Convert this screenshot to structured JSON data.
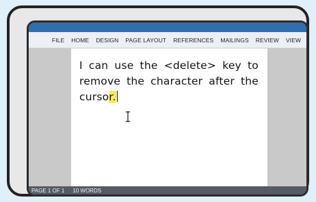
{
  "ribbon": {
    "tabs": [
      "FILE",
      "HOME",
      "DESIGN",
      "PAGE LAYOUT",
      "REFERENCES",
      "MAILINGS",
      "REVIEW",
      "VIEW"
    ]
  },
  "document": {
    "text_before_highlight": "I can use the <delete> key to remove the character after the curso",
    "highlighted_text": "r."
  },
  "status": {
    "page": "PAGE 1 OF 1",
    "words": "10 WORDS"
  },
  "colors": {
    "title_bar": "#2d6fb0",
    "highlight": "#f4ec5a"
  },
  "icons": {
    "mouse_pointer": "i-beam-cursor-icon"
  }
}
